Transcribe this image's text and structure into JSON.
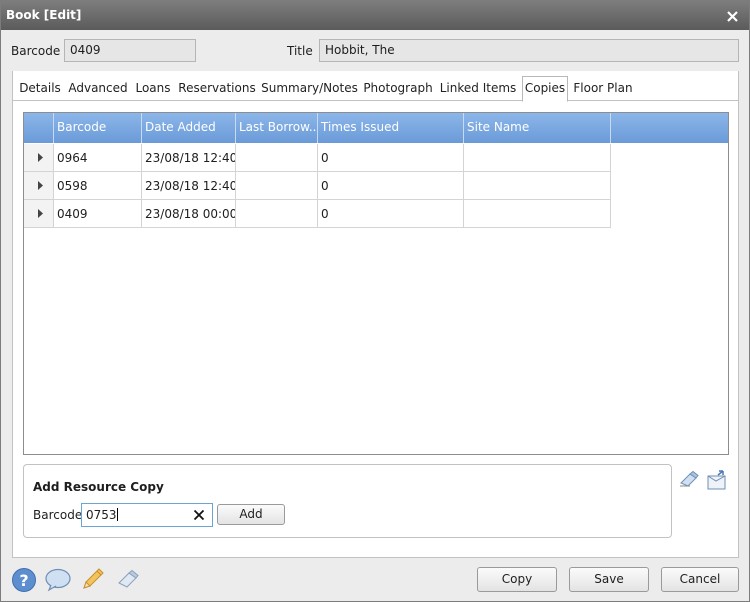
{
  "window": {
    "title": "Book [Edit]"
  },
  "header": {
    "barcode_label": "Barcode",
    "barcode_value": "0409",
    "title_label": "Title",
    "title_value": "Hobbit, The"
  },
  "tabs": [
    "Details",
    "Advanced",
    "Loans",
    "Reservations",
    "Summary/Notes",
    "Photograph",
    "Linked Items",
    "Copies",
    "Floor Plan"
  ],
  "active_tab": "Copies",
  "copies_table": {
    "columns": [
      "Barcode",
      "Date Added",
      "Last Borrow...",
      "Times Issued",
      "Site Name"
    ],
    "rows": [
      {
        "barcode": "0964",
        "date_added": "23/08/18 12:40",
        "last_borrowed": "",
        "times_issued": "0",
        "site_name": ""
      },
      {
        "barcode": "0598",
        "date_added": "23/08/18 12:40",
        "last_borrowed": "",
        "times_issued": "0",
        "site_name": ""
      },
      {
        "barcode": "0409",
        "date_added": "23/08/18 00:00",
        "last_borrowed": "",
        "times_issued": "0",
        "site_name": ""
      }
    ]
  },
  "add_copy": {
    "title": "Add Resource Copy",
    "barcode_label": "Barcode",
    "barcode_value": "0753",
    "add_label": "Add"
  },
  "footer": {
    "copy_label": "Copy",
    "save_label": "Save",
    "cancel_label": "Cancel"
  },
  "icons": [
    "help-icon",
    "comment-icon",
    "pencil-icon",
    "eraser-icon",
    "edit-copy-icon",
    "export-copy-icon"
  ],
  "colors": {
    "header_blue": "#7aa8e2",
    "titlebar": "#6a6a6a"
  }
}
